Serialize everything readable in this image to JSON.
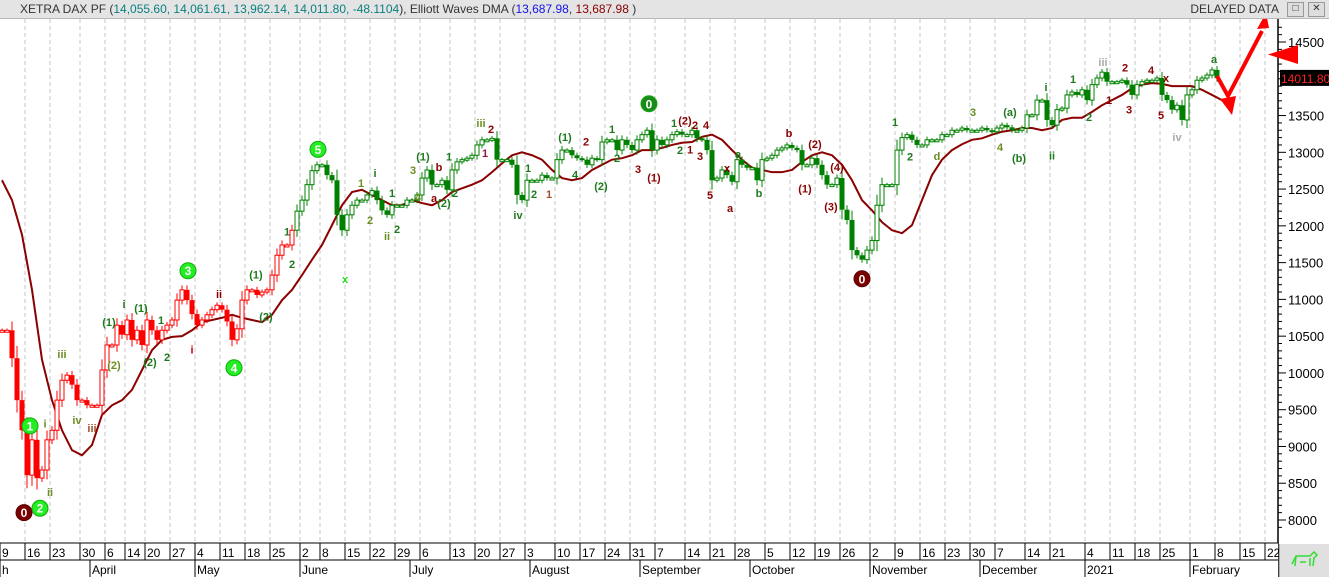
{
  "header": {
    "instrument": "XETRA DAX PF",
    "ohlc": "14,055.60, 14,061.61, 13,962.14, 14,011.80, -48.1104",
    "indicator": "Elliott Waves DMA",
    "dma_value_1": "13,687.98",
    "dma_value_2": "13,687.98",
    "delayed": "DELAYED DATA",
    "restore_btn": "□",
    "close_btn": "✕"
  },
  "colors": {
    "up_down_early": "#ff0000",
    "main": "#008000",
    "dma": "#8b0000",
    "label_dark": "#8b0000",
    "label_green": "#2e8b2e",
    "circle_green": "#22dd22",
    "arrow": "#ff0000"
  },
  "chart_data": {
    "type": "candlestick",
    "title": "XETRA DAX PF",
    "ylim": [
      7800,
      14800
    ],
    "y_ticks": [
      8000,
      8500,
      9000,
      9500,
      10000,
      10500,
      11000,
      11500,
      12000,
      12500,
      13000,
      13500,
      14000,
      14500
    ],
    "last_price": "14011.80",
    "last_price_value": 14011.8,
    "grid": "vertical dashed weekly",
    "closes": [
      10580,
      10580,
      10200,
      9630,
      9220,
      8610,
      9090,
      8570,
      8680,
      9090,
      9220,
      9630,
      9900,
      9970,
      9840,
      9630,
      9630,
      9560,
      9560,
      9560,
      10040,
      10380,
      10380,
      10650,
      10520,
      10720,
      10450,
      10580,
      10380,
      10720,
      10580,
      10450,
      10580,
      10650,
      10720,
      10990,
      11130,
      10990,
      10800,
      10650,
      10720,
      10790,
      10860,
      10920,
      10860,
      10700,
      10450,
      10600,
      10990,
      11130,
      11130,
      11060,
      11100,
      11130,
      11330,
      11600,
      11740,
      11740,
      11940,
      12200,
      12350,
      12560,
      12750,
      12830,
      12830,
      12690,
      12620,
      12150,
      11940,
      12150,
      12280,
      12350,
      12350,
      12420,
      12480,
      12350,
      12210,
      12150,
      12280,
      12280,
      12280,
      12350,
      12350,
      12420,
      12650,
      12760,
      12560,
      12560,
      12620,
      12490,
      12760,
      12870,
      12900,
      12920,
      12960,
      13100,
      13170,
      13170,
      13190,
      12900,
      12900,
      12900,
      12830,
      12420,
      12350,
      12620,
      12620,
      12620,
      12690,
      12650,
      12650,
      12900,
      13030,
      13030,
      12960,
      12920,
      12900,
      12830,
      12920,
      12900,
      13140,
      13170,
      13170,
      13030,
      13170,
      13100,
      13030,
      13170,
      13240,
      13300,
      13030,
      13170,
      13100,
      13170,
      13240,
      13280,
      13240,
      13240,
      13300,
      13190,
      13170,
      13030,
      12620,
      12650,
      12760,
      12690,
      12600,
      12900,
      12830,
      12790,
      12790,
      12620,
      12900,
      12920,
      12960,
      13030,
      13060,
      13100,
      13060,
      13030,
      12830,
      12830,
      12920,
      12830,
      12690,
      12560,
      12560,
      12650,
      12220,
      12080,
      11670,
      11600,
      11540,
      11670,
      11800,
      12280,
      12560,
      12560,
      12560,
      13030,
      13200,
      13240,
      13170,
      13100,
      13100,
      13170,
      13170,
      13170,
      13240,
      13240,
      13300,
      13300,
      13330,
      13300,
      13300,
      13300,
      13330,
      13300,
      13280,
      13330,
      13370,
      13340,
      13300,
      13300,
      13330,
      13510,
      13510,
      13710,
      13710,
      13440,
      13370,
      13580,
      13600,
      13780,
      13820,
      13780,
      13850,
      13710,
      13920,
      14010,
      14090,
      13960,
      13960,
      13960,
      13980,
      13920,
      13780,
      13920,
      13960,
      13980,
      13980,
      14010,
      13780,
      13710,
      13580,
      13640,
      13440,
      13780,
      13850,
      13980,
      14010,
      14050,
      14120,
      14012
    ],
    "color_segments": [
      {
        "from": 0,
        "to": 58,
        "color": "#ff0000"
      },
      {
        "from": 59,
        "to": 243,
        "color": "#008000"
      }
    ],
    "dma_step": 2,
    "dma": [
      12620,
      12350,
      11880,
      11130,
      10180,
      9630,
      9220,
      8950,
      8880,
      9020,
      9430,
      9560,
      9630,
      9770,
      10040,
      10310,
      10450,
      10490,
      10500,
      10580,
      10690,
      10720,
      10750,
      10790,
      10750,
      10720,
      10690,
      10790,
      10990,
      11130,
      11330,
      11540,
      11740,
      12010,
      12280,
      12460,
      12490,
      12420,
      12350,
      12280,
      12280,
      12350,
      12310,
      12280,
      12350,
      12460,
      12510,
      12560,
      12620,
      12730,
      12850,
      12960,
      13000,
      12960,
      12900,
      12760,
      12650,
      12620,
      12650,
      12760,
      12830,
      12900,
      12920,
      12960,
      13030,
      13030,
      13060,
      13100,
      13130,
      13140,
      13210,
      13240,
      13170,
      13030,
      12900,
      12790,
      12760,
      12730,
      12730,
      12760,
      12870,
      12960,
      13000,
      12960,
      12830,
      12620,
      12350,
      12210,
      12050,
      11940,
      11900,
      12010,
      12350,
      12690,
      12900,
      13030,
      13110,
      13170,
      13190,
      13240,
      13280,
      13300,
      13330,
      13330,
      13300,
      13330,
      13440,
      13470,
      13470,
      13550,
      13640,
      13710,
      13780,
      13870,
      13920,
      13940,
      13930,
      13900,
      13900,
      13900,
      13850,
      13780,
      13710,
      13710
    ],
    "x_week_labels": [
      {
        "t": "9",
        "i": 0
      },
      {
        "t": "16",
        "i": 5
      },
      {
        "t": "23",
        "i": 10
      },
      {
        "t": "30",
        "i": 16
      },
      {
        "t": "6",
        "i": 21
      },
      {
        "t": "14",
        "i": 25
      },
      {
        "t": "20",
        "i": 29
      },
      {
        "t": "27",
        "i": 34
      },
      {
        "t": "4",
        "i": 39
      },
      {
        "t": "11",
        "i": 44
      },
      {
        "t": "18",
        "i": 49
      },
      {
        "t": "25",
        "i": 54
      },
      {
        "t": "2",
        "i": 60
      },
      {
        "t": "8",
        "i": 64
      },
      {
        "t": "15",
        "i": 69
      },
      {
        "t": "22",
        "i": 74
      },
      {
        "t": "29",
        "i": 79
      },
      {
        "t": "6",
        "i": 84
      },
      {
        "t": "13",
        "i": 90
      },
      {
        "t": "20",
        "i": 95
      },
      {
        "t": "27",
        "i": 100
      },
      {
        "t": "3",
        "i": 105
      },
      {
        "t": "10",
        "i": 111
      },
      {
        "t": "17",
        "i": 116
      },
      {
        "t": "24",
        "i": 121
      },
      {
        "t": "31",
        "i": 126
      },
      {
        "t": "7",
        "i": 131
      },
      {
        "t": "14",
        "i": 137
      },
      {
        "t": "21",
        "i": 142
      },
      {
        "t": "28",
        "i": 147
      },
      {
        "t": "5",
        "i": 153
      },
      {
        "t": "12",
        "i": 158
      },
      {
        "t": "19",
        "i": 163
      },
      {
        "t": "26",
        "i": 168
      },
      {
        "t": "2",
        "i": 174
      },
      {
        "t": "9",
        "i": 179
      },
      {
        "t": "16",
        "i": 184
      },
      {
        "t": "23",
        "i": 189
      },
      {
        "t": "30",
        "i": 194
      },
      {
        "t": "7",
        "i": 199
      },
      {
        "t": "14",
        "i": 205
      },
      {
        "t": "21",
        "i": 210
      },
      {
        "t": "4",
        "i": 217
      },
      {
        "t": "11",
        "i": 222
      },
      {
        "t": "18",
        "i": 227
      },
      {
        "t": "25",
        "i": 232
      },
      {
        "t": "1",
        "i": 238
      },
      {
        "t": "8",
        "i": 243
      },
      {
        "t": "15",
        "i": 248
      },
      {
        "t": "22",
        "i": 253
      }
    ],
    "x_month_labels": [
      {
        "t": "h",
        "i": 0
      },
      {
        "t": "April",
        "i": 18
      },
      {
        "t": "May",
        "i": 39
      },
      {
        "t": "June",
        "i": 60
      },
      {
        "t": "July",
        "i": 82
      },
      {
        "t": "August",
        "i": 106
      },
      {
        "t": "September",
        "i": 128
      },
      {
        "t": "October",
        "i": 150
      },
      {
        "t": "November",
        "i": 174
      },
      {
        "t": "December",
        "i": 196
      },
      {
        "t": "2021",
        "i": 217
      },
      {
        "t": "February",
        "i": 238
      }
    ],
    "wave_labels": [
      {
        "t": "0",
        "i": 4.4,
        "p": 8100,
        "c": "dark",
        "circle": true
      },
      {
        "t": "1",
        "i": 5.6,
        "p": 9280,
        "c": "bright",
        "circle": true
      },
      {
        "t": "2",
        "i": 7.6,
        "p": 8160,
        "c": "bright",
        "circle": true
      },
      {
        "t": "i",
        "i": 8.6,
        "p": 9310,
        "c": "olive"
      },
      {
        "t": "ii",
        "i": 9.6,
        "p": 8380,
        "c": "olive"
      },
      {
        "t": "iii",
        "i": 12,
        "p": 10260,
        "c": "olive"
      },
      {
        "t": "iv",
        "i": 15,
        "p": 9360,
        "c": "olive"
      },
      {
        "t": "iii",
        "i": 18,
        "p": 9250,
        "c": "brown"
      },
      {
        "t": "(1)",
        "i": 21.4,
        "p": 10690,
        "c": "green"
      },
      {
        "t": "(2)",
        "i": 22.4,
        "p": 10110,
        "c": "olive"
      },
      {
        "t": "i",
        "i": 24.4,
        "p": 10940,
        "c": "green"
      },
      {
        "t": "(1)",
        "i": 27.8,
        "p": 10880,
        "c": "green"
      },
      {
        "t": "(2)",
        "i": 29.6,
        "p": 10150,
        "c": "green"
      },
      {
        "t": "1",
        "i": 31.8,
        "p": 10720,
        "c": "green"
      },
      {
        "t": "2",
        "i": 33,
        "p": 10220,
        "c": "green"
      },
      {
        "t": "3",
        "i": 37.2,
        "p": 11390,
        "c": "bright",
        "circle": true
      },
      {
        "t": "i",
        "i": 38,
        "p": 10320,
        "c": "red"
      },
      {
        "t": "ii",
        "i": 43.4,
        "p": 11070,
        "c": "dark"
      },
      {
        "t": "4",
        "i": 46.4,
        "p": 10070,
        "c": "bright",
        "circle": true
      },
      {
        "t": "(1)",
        "i": 50.8,
        "p": 11340,
        "c": "green"
      },
      {
        "t": "(2)",
        "i": 52.8,
        "p": 10770,
        "c": "green"
      },
      {
        "t": "1",
        "i": 57,
        "p": 11920,
        "c": "green"
      },
      {
        "t": "2",
        "i": 58,
        "p": 11480,
        "c": "green"
      },
      {
        "t": "5",
        "i": 63.2,
        "p": 13040,
        "c": "bright",
        "circle": true
      },
      {
        "t": "x",
        "i": 68.6,
        "p": 11280,
        "c": "bright"
      },
      {
        "t": "1",
        "i": 71.8,
        "p": 12580,
        "c": "olive"
      },
      {
        "t": "i",
        "i": 74.6,
        "p": 12720,
        "c": "green"
      },
      {
        "t": "2",
        "i": 73.6,
        "p": 12080,
        "c": "olive"
      },
      {
        "t": "ii",
        "i": 77,
        "p": 11860,
        "c": "olive"
      },
      {
        "t": "1",
        "i": 78,
        "p": 12450,
        "c": "green"
      },
      {
        "t": "2",
        "i": 79,
        "p": 11960,
        "c": "green"
      },
      {
        "t": "3",
        "i": 82.2,
        "p": 12760,
        "c": "olive"
      },
      {
        "t": "4",
        "i": 83.2,
        "p": 12390,
        "c": "olive"
      },
      {
        "t": "(1)",
        "i": 84.2,
        "p": 12940,
        "c": "green"
      },
      {
        "t": "b",
        "i": 87.4,
        "p": 12800,
        "c": "dark"
      },
      {
        "t": "a",
        "i": 86.4,
        "p": 12380,
        "c": "dark"
      },
      {
        "t": "(2)",
        "i": 88.4,
        "p": 12310,
        "c": "green"
      },
      {
        "t": "1",
        "i": 89.4,
        "p": 12940,
        "c": "green"
      },
      {
        "t": "2",
        "i": 90.6,
        "p": 12450,
        "c": "green"
      },
      {
        "t": "iii",
        "i": 95.8,
        "p": 13400,
        "c": "olive"
      },
      {
        "t": "2",
        "i": 97.8,
        "p": 13320,
        "c": "dark"
      },
      {
        "t": "1",
        "i": 96.6,
        "p": 12990,
        "c": "purple"
      },
      {
        "t": "iv",
        "i": 103.2,
        "p": 12150,
        "c": "green"
      },
      {
        "t": "1",
        "i": 105.2,
        "p": 12790,
        "c": "green"
      },
      {
        "t": "2",
        "i": 106.4,
        "p": 12430,
        "c": "green"
      },
      {
        "t": "1",
        "i": 109.4,
        "p": 12430,
        "c": "brown"
      },
      {
        "t": "(1)",
        "i": 112.6,
        "p": 13210,
        "c": "green"
      },
      {
        "t": "2",
        "i": 116.8,
        "p": 13150,
        "c": "dark"
      },
      {
        "t": "4",
        "i": 114.6,
        "p": 12700,
        "c": "green"
      },
      {
        "t": "(2)",
        "i": 119.8,
        "p": 12540,
        "c": "green"
      },
      {
        "t": "1",
        "i": 122,
        "p": 13320,
        "c": "green"
      },
      {
        "t": "2",
        "i": 123,
        "p": 12920,
        "c": "green"
      },
      {
        "t": "3",
        "i": 127.2,
        "p": 12770,
        "c": "dark"
      },
      {
        "t": "0",
        "i": 129.4,
        "p": 13660,
        "c": "green",
        "circle": true
      },
      {
        "t": "(1)",
        "i": 130.4,
        "p": 12660,
        "c": "dark"
      },
      {
        "t": "1",
        "i": 134.4,
        "p": 13400,
        "c": "green"
      },
      {
        "t": "(2)",
        "i": 136.6,
        "p": 13430,
        "c": "dark"
      },
      {
        "t": "2",
        "i": 138.6,
        "p": 13370,
        "c": "dark"
      },
      {
        "t": "4",
        "i": 140.8,
        "p": 13370,
        "c": "dark"
      },
      {
        "t": "2",
        "i": 135.6,
        "p": 13030,
        "c": "green"
      },
      {
        "t": "1",
        "i": 137.6,
        "p": 13040,
        "c": "dark"
      },
      {
        "t": "3",
        "i": 139.6,
        "p": 12950,
        "c": "dark"
      },
      {
        "t": "5",
        "i": 141.6,
        "p": 12420,
        "c": "dark"
      },
      {
        "t": "a",
        "i": 145.6,
        "p": 12240,
        "c": "dark"
      },
      {
        "t": "x",
        "i": 145,
        "p": 12790,
        "c": "dark"
      },
      {
        "t": "a",
        "i": 147.2,
        "p": 12980,
        "c": "green"
      },
      {
        "t": "b",
        "i": 151.4,
        "p": 12450,
        "c": "green"
      },
      {
        "t": "b",
        "i": 157.4,
        "p": 13260,
        "c": "dark"
      },
      {
        "t": "(1)",
        "i": 160.6,
        "p": 12510,
        "c": "dark"
      },
      {
        "t": "(2)",
        "i": 162.6,
        "p": 13110,
        "c": "dark"
      },
      {
        "t": "(4)",
        "i": 167,
        "p": 12800,
        "c": "dark"
      },
      {
        "t": "(3)",
        "i": 165.8,
        "p": 12260,
        "c": "dark"
      },
      {
        "t": "0",
        "i": 172,
        "p": 11280,
        "c": "dark",
        "circle": true
      },
      {
        "t": "1",
        "i": 178.6,
        "p": 13410,
        "c": "green"
      },
      {
        "t": "2",
        "i": 181.6,
        "p": 12940,
        "c": "green"
      },
      {
        "t": "d",
        "i": 187,
        "p": 12950,
        "c": "olive"
      },
      {
        "t": "3",
        "i": 194.2,
        "p": 13550,
        "c": "olive"
      },
      {
        "t": "4",
        "i": 199.6,
        "p": 13070,
        "c": "olive"
      },
      {
        "t": "(a)",
        "i": 201.6,
        "p": 13550,
        "c": "green"
      },
      {
        "t": "(b)",
        "i": 203.4,
        "p": 12920,
        "c": "green"
      },
      {
        "t": "i",
        "i": 208.8,
        "p": 13890,
        "c": "green"
      },
      {
        "t": "ii",
        "i": 210,
        "p": 12960,
        "c": "green"
      },
      {
        "t": "1",
        "i": 214.2,
        "p": 14000,
        "c": "green"
      },
      {
        "t": "2",
        "i": 217.4,
        "p": 13480,
        "c": "green"
      },
      {
        "t": "1",
        "i": 221.4,
        "p": 13710,
        "c": "dark"
      },
      {
        "t": "iii",
        "i": 220.2,
        "p": 14230,
        "c": "gray"
      },
      {
        "t": "2",
        "i": 224.6,
        "p": 14150,
        "c": "dark"
      },
      {
        "t": "3",
        "i": 225.4,
        "p": 13580,
        "c": "dark"
      },
      {
        "t": "4",
        "i": 229.8,
        "p": 14120,
        "c": "dark"
      },
      {
        "t": "x",
        "i": 232.8,
        "p": 14010,
        "c": "dark"
      },
      {
        "t": "5",
        "i": 231.8,
        "p": 13510,
        "c": "dark"
      },
      {
        "t": "iv",
        "i": 235,
        "p": 13210,
        "c": "gray"
      },
      {
        "t": "a",
        "i": 242.4,
        "p": 14270,
        "c": "green"
      }
    ]
  }
}
